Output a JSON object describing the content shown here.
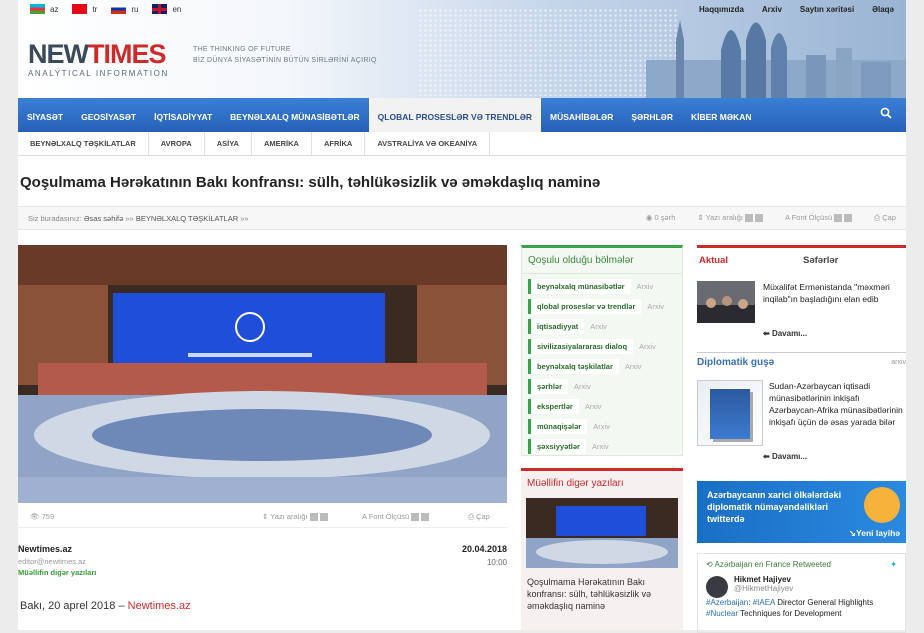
{
  "languages": [
    {
      "code": "az",
      "flag": "az-flag-icon"
    },
    {
      "code": "tr",
      "flag": "tr-flag-icon"
    },
    {
      "code": "ru",
      "flag": "ru-flag-icon"
    },
    {
      "code": "en",
      "flag": "en-flag-icon"
    }
  ],
  "top_links": [
    "Haqqımızda",
    "Arxiv",
    "Saytın xəritəsi",
    "Əlaqə"
  ],
  "logo": {
    "part1": "NEW",
    "part2": "TIMES",
    "sub": "ANALYTICAL INFORMATION"
  },
  "slogan": {
    "line1": "THE THINKING OF FUTURE",
    "line2": "BİZ DÜNYA SİYASƏTİNİN BÜTÜN SİRLƏRİNİ AÇIRIQ"
  },
  "nav": [
    "SİYASƏT",
    "GEOSİYASƏT",
    "İQTİSADİYYAT",
    "BEYNƏLXALQ MÜNASİBƏTLƏR",
    "QLOBAL PROSESLƏR VƏ TRENDLƏR",
    "MÜSAHİBƏLƏR",
    "ŞƏRHLƏR",
    "KİBER MƏKAN"
  ],
  "nav_highlight_index": 4,
  "subnav": [
    "BEYNƏLXALQ TƏŞKİLATLAR",
    "AVROPA",
    "ASİYA",
    "AMERİKA",
    "AFRİKA",
    "AVSTRALİYA VƏ OKEANİYA"
  ],
  "article": {
    "title": "Qoşulmama Hərəkatının Bakı konfransı: sülh, təhlükəsizlik və əməkdaşlıq naminə",
    "views": "759",
    "author": "Newtimes.az",
    "email": "editor@newtimes.az",
    "author_link": "Müəllifin digər yazıları",
    "date": "20.04.2018",
    "time": "10:00",
    "lead_city": "Bakı, 20 aprel 2018 – ",
    "lead_source": "Newtimes.az"
  },
  "breadcrumb": {
    "prefix": "Siz buradasınız:",
    "home": "Əsas səhifə",
    "sep": "»»",
    "section": "BEYNƏLXALQ TƏŞKİLATLAR"
  },
  "tools": {
    "comments": "0 şərh",
    "line_spacing": "Yazı aralığı",
    "font_size": "Font Ölçüsü",
    "print": "Çap"
  },
  "related_sections": {
    "title": "Qoşulu olduğu bölmələr",
    "archive": "Arxiv",
    "tags": [
      "beynəlxalq münasibətlər",
      "qlobal proseslər və trendlər",
      "iqtisadiyyat",
      "sivilizasiyalararası dialoq",
      "beynəlxalq təşkilatlar",
      "şərhlər",
      "ekspertlər",
      "münaqişələr",
      "şəxsiyyətlər"
    ]
  },
  "author_other": {
    "title": "Müəllifin digər yazıları",
    "item": "Qoşulmama Hərəkatının Bakı konfransı: sülh, təhlükəsizlik və əməkdaşlıq naminə"
  },
  "right": {
    "tab1": "Aktual",
    "tab2": "Səfərlər",
    "news1": "Müxalifət Ermənistanda \"məxməri inqilab\"ın başladığını elan edib",
    "more": "Davamı...",
    "dipl_title": "Diplomatik guşə",
    "dipl_archive": "arxiv",
    "dipl_text": "Sudan-Azərbaycan iqtisadi münasibətlərinin inkişafı Azərbaycan-Afrika münasibətlərinin inkişafı üçün də əsas yarada bilər",
    "banner_text": "Azərbaycanın xarici ölkələrdəki diplomatik nümayəndəlikləri twitterdə",
    "banner_link": "Yeni layihə",
    "tweet_rt": "Azərbaijan en France Retweeted",
    "tweet_name": "Hikmet Hajiyev",
    "tweet_handle": "@HikmetHajiyev",
    "tweet_tag1": "#Azerbaijan",
    "tweet_tag2": "#IAEA",
    "tweet_text1": "Director General Highlights",
    "tweet_tag3": "#Nuclear",
    "tweet_text2": "Techniques for Development"
  },
  "colors": {
    "accent_blue": "#2761b7",
    "accent_red": "#cf2a2a",
    "accent_green": "#3aa24a"
  }
}
